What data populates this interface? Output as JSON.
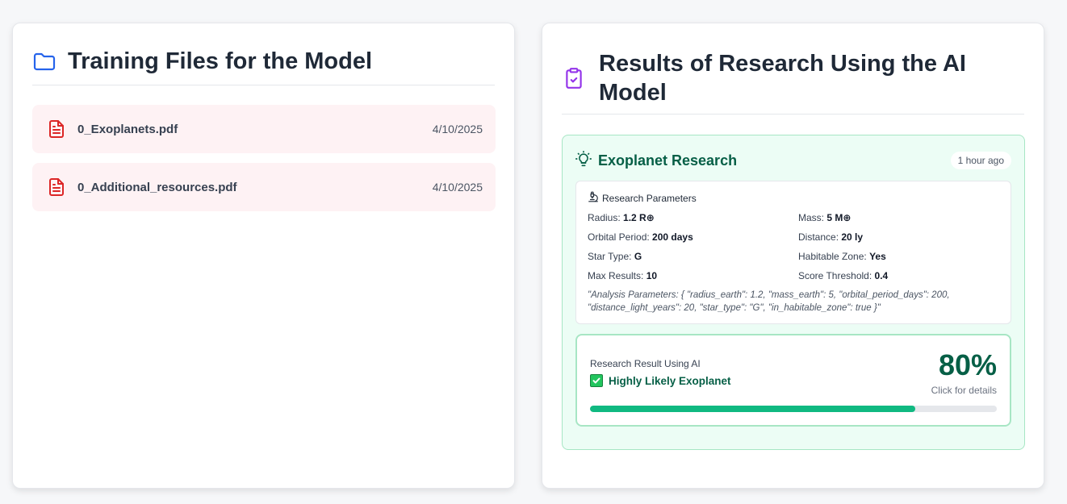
{
  "colors": {
    "folder_icon": "#2563eb",
    "file_icon": "#dc2626",
    "clipboard_icon": "#9333ea",
    "accent_green": "#065f46",
    "progress": "#10b981"
  },
  "training": {
    "title": "Training Files for the Model",
    "icon": "folder-icon",
    "files": [
      {
        "name": "0_Exoplanets.pdf",
        "date": "4/10/2025",
        "icon": "file-icon"
      },
      {
        "name": "0_Additional_resources.pdf",
        "date": "4/10/2025",
        "icon": "file-icon"
      }
    ]
  },
  "results": {
    "title": "Results of Research Using the AI Model",
    "icon": "clipboard-check-icon",
    "card": {
      "title": "Exoplanet Research",
      "icon": "lightbulb-icon",
      "time": "1 hour ago",
      "params": {
        "heading": "Research Parameters",
        "icon": "microscope-icon",
        "items": [
          {
            "label": "Radius:",
            "value": "1.2 R⊕"
          },
          {
            "label": "Mass:",
            "value": "5 M⊕"
          },
          {
            "label": "Orbital Period:",
            "value": "200 days"
          },
          {
            "label": "Distance:",
            "value": "20 ly"
          },
          {
            "label": "Star Type:",
            "value": "G"
          },
          {
            "label": "Habitable Zone:",
            "value": "Yes"
          },
          {
            "label": "Max Results:",
            "value": "10"
          },
          {
            "label": "Score Threshold:",
            "value": "0.4"
          }
        ],
        "note": "\"Analysis Parameters: { \"radius_earth\": 1.2, \"mass_earth\": 5, \"orbital_period_days\": 200, \"distance_light_years\": 20, \"star_type\": \"G\", \"in_habitable_zone\": true }\""
      },
      "result": {
        "label": "Research Result Using AI",
        "verdict": "Highly Likely Exoplanet",
        "verdict_icon": "check-mark-icon",
        "score": "80%",
        "score_fraction": 0.8,
        "hint": "Click for details"
      }
    }
  }
}
